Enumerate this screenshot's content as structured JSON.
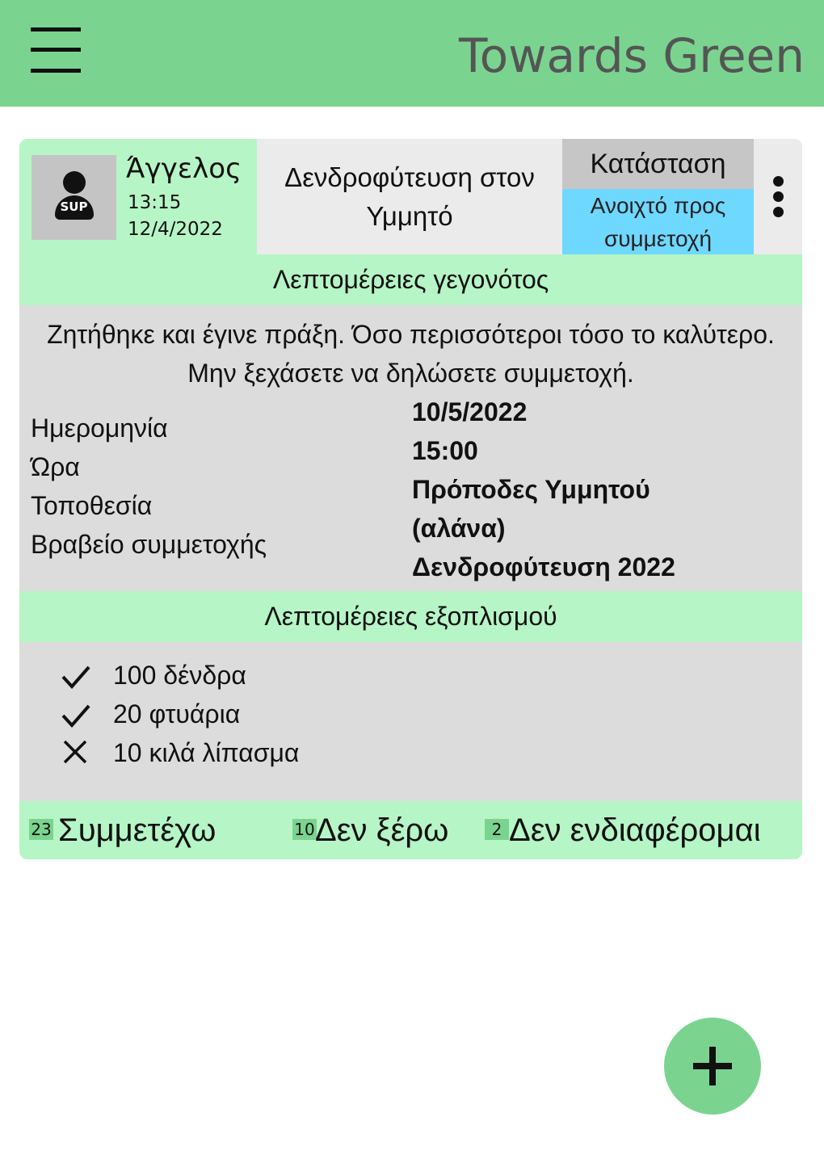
{
  "header": {
    "title": "Towards Green",
    "menu_icon": "hamburger-menu-icon",
    "background": "#7ad48f"
  },
  "event": {
    "author": {
      "name": "Άγγελος",
      "time": "13:15",
      "date": "12/4/2022",
      "badge": "SUP",
      "avatar_icon": "user-icon"
    },
    "title": "Δενδροφύτευση στον Υμμητό",
    "status": {
      "label": "Κατάσταση",
      "value": "Ανοιχτό προς συμμετοχή",
      "color": "#6fd8ff"
    },
    "more_icon": "more-vertical-icon",
    "details_header": "Λεπτομέρειες γεγονότος",
    "description": "Ζητήθηκε και έγινε πράξη. Όσο περισσότεροι τόσο το καλύτερο. Μην ξεχάσετε να δηλώσετε συμμετοχή.",
    "fields": {
      "date_label": "Ημερομηνία",
      "time_label": "Ώρα",
      "location_label": "Τοποθεσία",
      "award_label": "Βραβείο συμμετοχής",
      "date_value": "10/5/2022",
      "time_value": "15:00",
      "location_value_line1": "Πρόποδες Υμμητού",
      "location_value_line2": "(αλάνα)",
      "award_value": "Δενδροφύτευση 2022"
    },
    "equipment_header": "Λεπτομέρειες εξοπλισμού",
    "equipment": [
      {
        "text": "100 δένδρα",
        "icon": "check-icon",
        "available": true
      },
      {
        "text": "20 φτυάρια",
        "icon": "check-icon",
        "available": true
      },
      {
        "text": "10 κιλά λίπασμα",
        "icon": "cross-icon",
        "available": false
      }
    ],
    "rsvp": {
      "going": {
        "count": "23",
        "label": "Συμμετέχω"
      },
      "maybe": {
        "count": "10",
        "label": "Δεν ξέρω"
      },
      "not_going": {
        "count": "2",
        "label": "Δεν ενδιαφέρομαι"
      }
    }
  },
  "fab": {
    "icon": "plus-icon",
    "color": "#7ad48f"
  }
}
